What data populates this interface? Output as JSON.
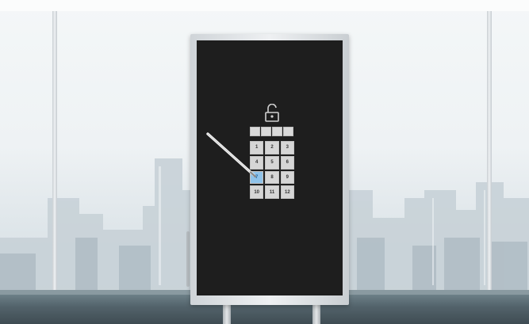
{
  "keypad": {
    "keys": [
      "1",
      "2",
      "3",
      "4",
      "5",
      "6",
      "7",
      "8",
      "9",
      "10",
      "11",
      "12"
    ],
    "active_key": "7"
  },
  "pin_boxes": 4,
  "icons": {
    "lock": "unlocked-padlock-icon",
    "stylus": "stylus-pen-icon"
  },
  "colors": {
    "screen": "#1e1e1e",
    "key": "#d6d6d6",
    "key_active": "#8fc3ea"
  }
}
